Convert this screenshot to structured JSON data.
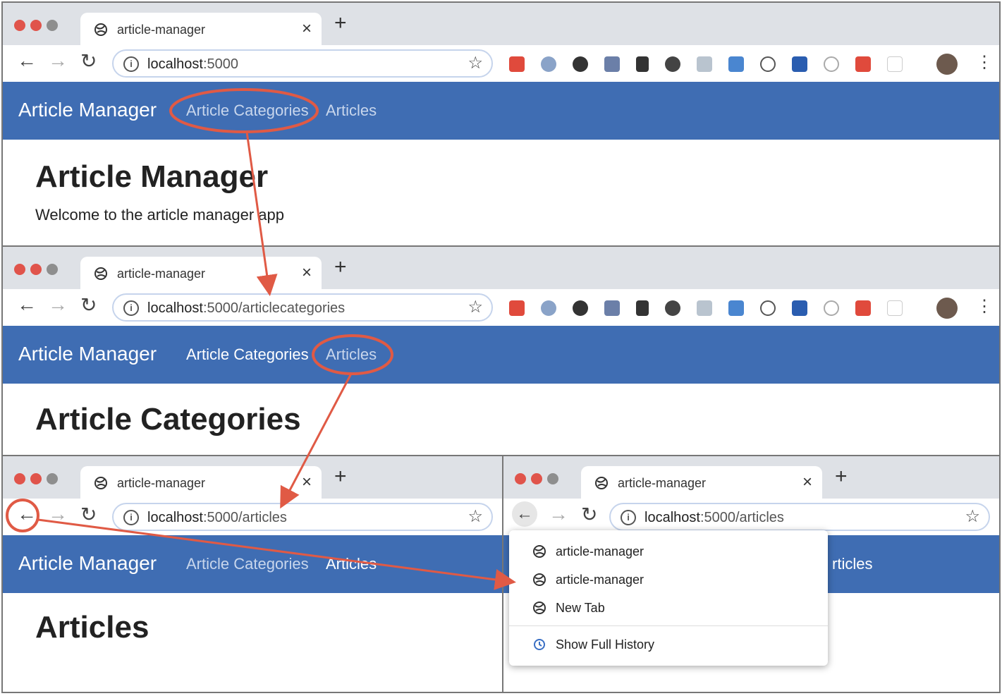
{
  "tab_title": "article-manager",
  "brand": "Article Manager",
  "nav": {
    "categories": "Article Categories",
    "articles": "Articles"
  },
  "frame1": {
    "url_host": "localhost",
    "url_rest": ":5000",
    "heading": "Article Manager",
    "text": "Welcome to the article manager app"
  },
  "frame2": {
    "url_host": "localhost",
    "url_rest": ":5000/articlecategories",
    "heading": "Article Categories"
  },
  "frame3": {
    "url_host": "localhost",
    "url_rest": ":5000/articles",
    "heading": "Articles"
  },
  "frame4": {
    "url_host": "localhost",
    "url_rest": ":5000/articles",
    "nav_partial": "rticles"
  },
  "history_menu": {
    "items": [
      "article-manager",
      "article-manager",
      "New Tab"
    ],
    "show_full": "Show Full History"
  },
  "colors": {
    "navbar": "#3f6db3",
    "annotation": "#e05a45",
    "chrome": "#dee1e6"
  }
}
